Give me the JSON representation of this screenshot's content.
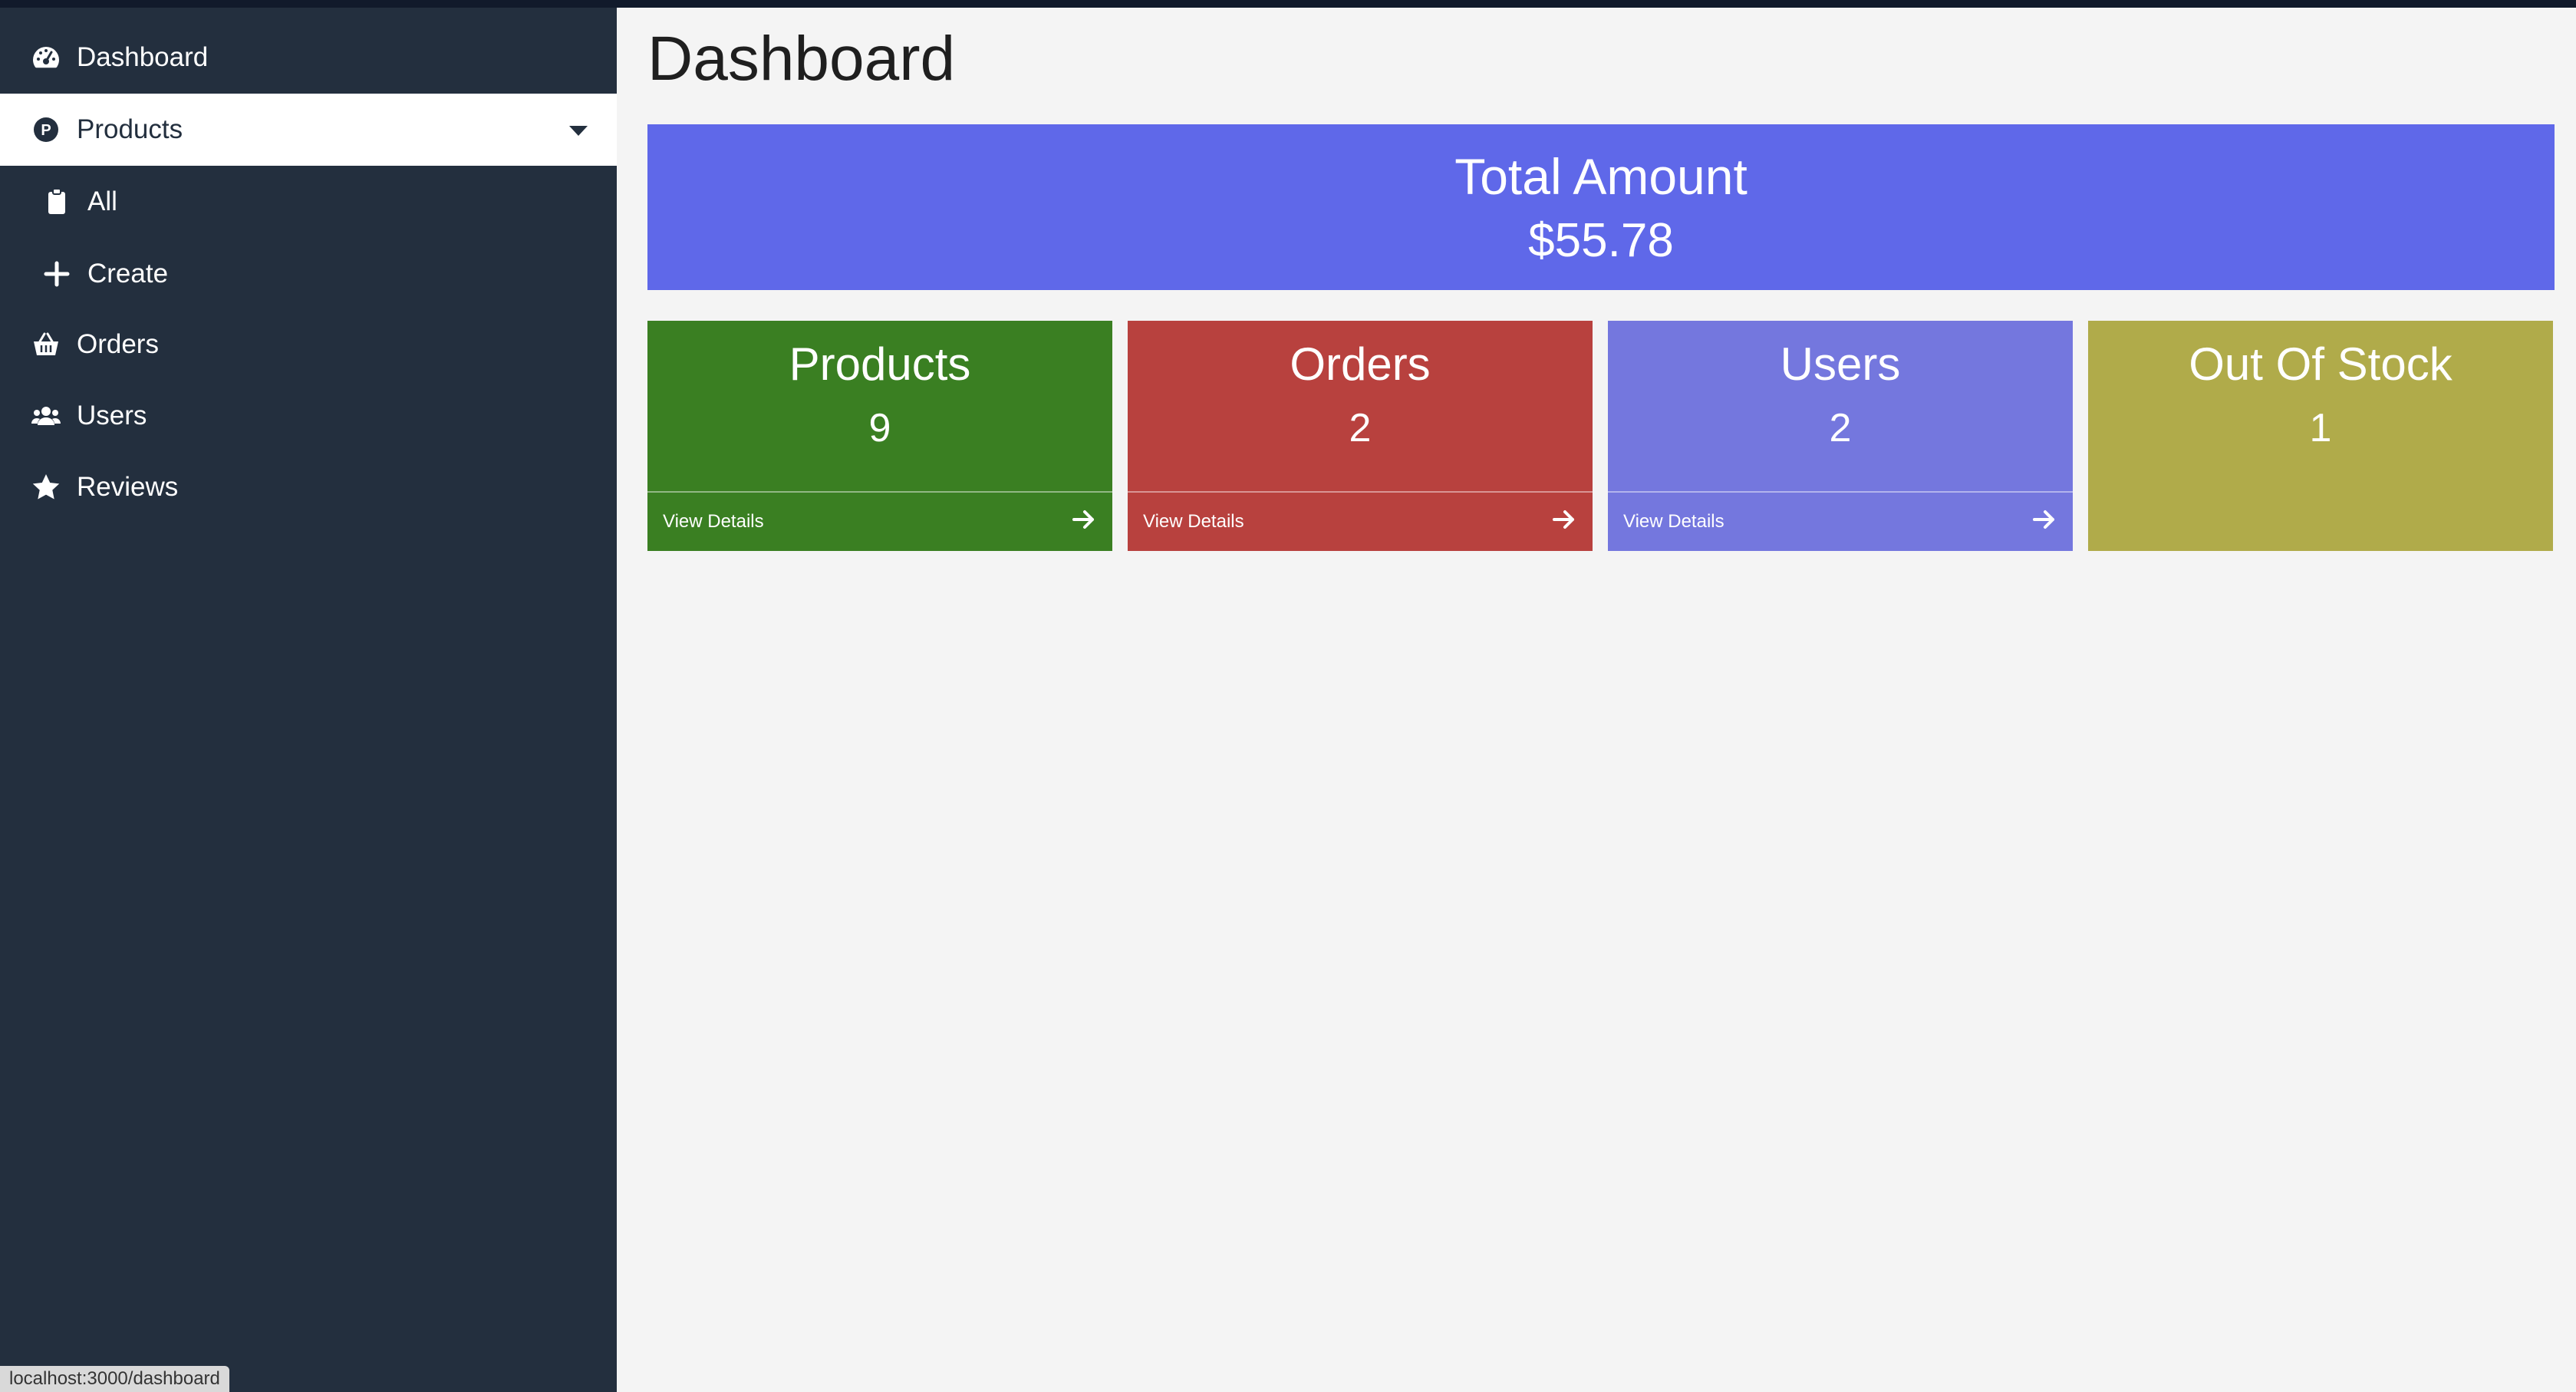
{
  "sidebar": {
    "items": [
      {
        "label": "Dashboard",
        "icon": "tachometer-icon"
      },
      {
        "label": "Products",
        "icon": "product-p-icon"
      },
      {
        "label": "All",
        "icon": "clipboard-icon"
      },
      {
        "label": "Create",
        "icon": "plus-icon"
      },
      {
        "label": "Orders",
        "icon": "basket-icon"
      },
      {
        "label": "Users",
        "icon": "users-icon"
      },
      {
        "label": "Reviews",
        "icon": "star-icon"
      }
    ]
  },
  "status_url": "localhost:3000/dashboard",
  "main": {
    "title": "Dashboard",
    "total": {
      "label": "Total Amount",
      "value": "$55.78"
    },
    "cards": [
      {
        "title": "Products",
        "value": "9",
        "footer": "View Details",
        "color": "#3a7f22"
      },
      {
        "title": "Orders",
        "value": "2",
        "footer": "View Details",
        "color": "#b8413e"
      },
      {
        "title": "Users",
        "value": "2",
        "footer": "View Details",
        "color": "#7477de"
      },
      {
        "title": "Out Of Stock",
        "value": "1",
        "color": "#b0ab4a"
      }
    ]
  },
  "colors": {
    "sidebar_bg": "#232f3e",
    "content_bg": "#f4f4f4",
    "total_bg": "#5f68e9"
  }
}
